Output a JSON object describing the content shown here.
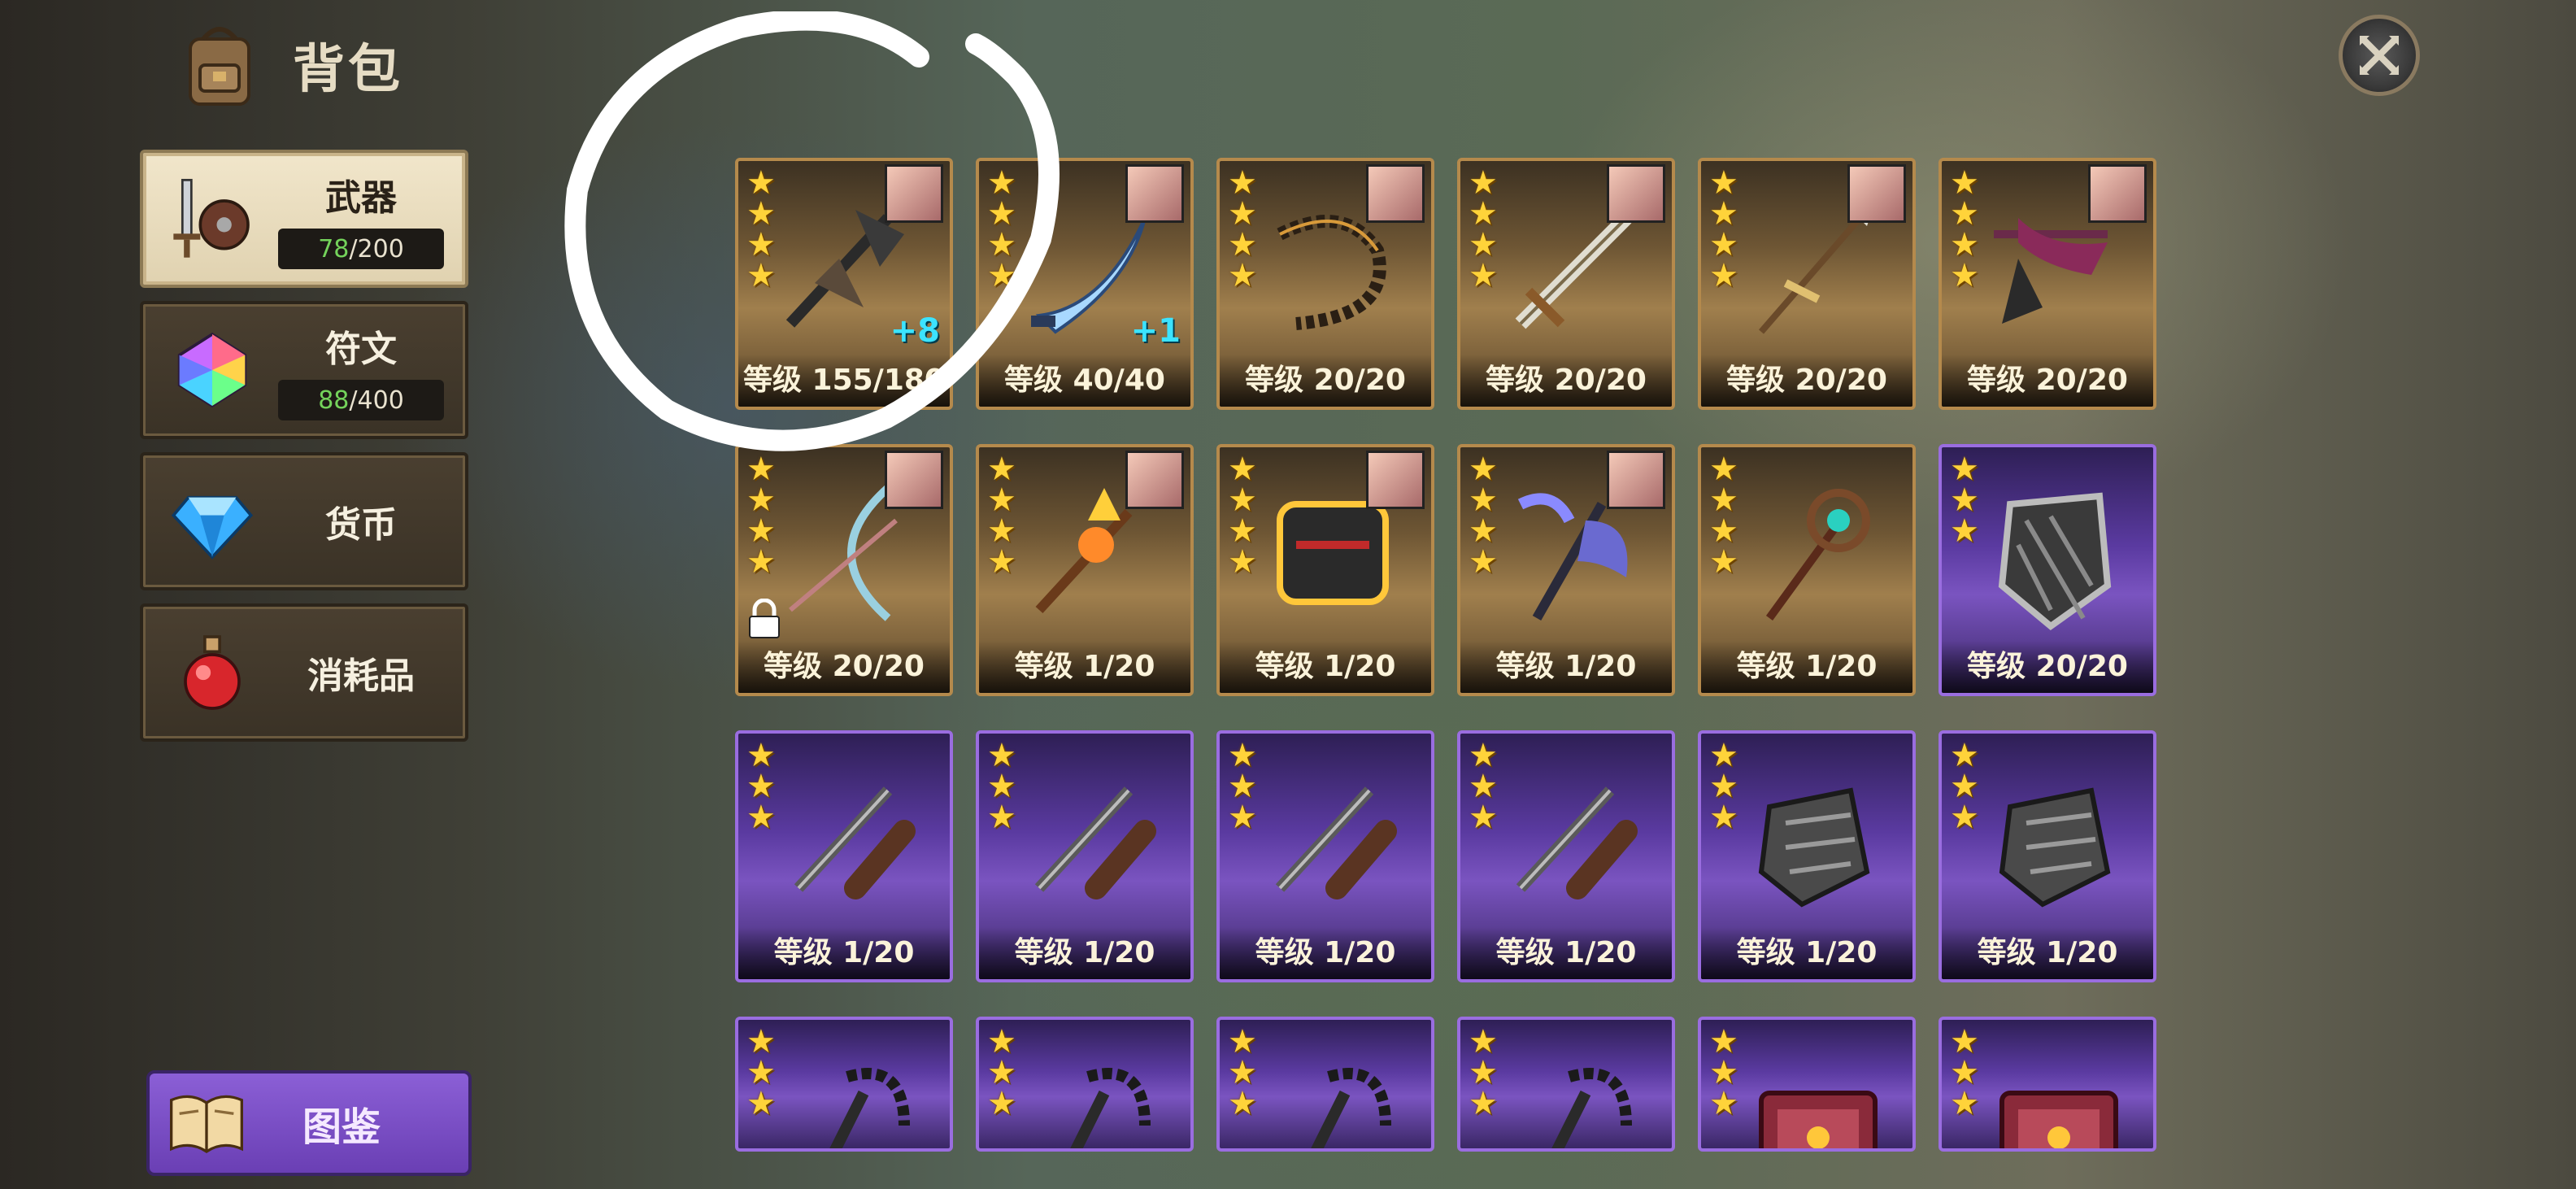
{
  "header": {
    "title": "背包",
    "icon": "backpack-icon"
  },
  "close_button": {
    "icon": "close-icon"
  },
  "categories": [
    {
      "label": "武器",
      "icon": "sword-shield-icon",
      "current": "78",
      "total": "/200",
      "active": true
    },
    {
      "label": "符文",
      "icon": "rainbow-gem-icon",
      "current": "88",
      "total": "/400",
      "active": false
    },
    {
      "label": "货币",
      "icon": "blue-diamond-icon",
      "active": false
    },
    {
      "label": "消耗品",
      "icon": "potion-icon",
      "active": false
    }
  ],
  "atlas_button": {
    "label": "图鉴",
    "icon": "book-icon"
  },
  "items": [
    {
      "rarity": "gold",
      "stars": 4,
      "level": "等级 155/180",
      "plus": "+8",
      "portrait": true,
      "art": "dark-halberd",
      "locked": false
    },
    {
      "rarity": "gold",
      "stars": 4,
      "level": "等级 40/40",
      "plus": "+1",
      "portrait": true,
      "art": "ice-scimitar",
      "locked": false
    },
    {
      "rarity": "gold",
      "stars": 4,
      "level": "等级 20/20",
      "plus": "",
      "portrait": true,
      "art": "chain-whip",
      "locked": false
    },
    {
      "rarity": "gold",
      "stars": 4,
      "level": "等级 20/20",
      "plus": "",
      "portrait": true,
      "art": "greatsword",
      "locked": false
    },
    {
      "rarity": "gold",
      "stars": 4,
      "level": "等级 20/20",
      "plus": "",
      "portrait": true,
      "art": "spear",
      "locked": false
    },
    {
      "rarity": "gold",
      "stars": 4,
      "level": "等级 20/20",
      "plus": "",
      "portrait": true,
      "art": "dragon-crossbow",
      "locked": false
    },
    {
      "rarity": "gold",
      "stars": 4,
      "level": "等级 20/20",
      "plus": "",
      "portrait": true,
      "art": "bow",
      "locked": true
    },
    {
      "rarity": "gold",
      "stars": 4,
      "level": "等级 1/20",
      "plus": "",
      "portrait": true,
      "art": "fire-staff",
      "locked": false
    },
    {
      "rarity": "gold",
      "stars": 4,
      "level": "等级 1/20",
      "plus": "",
      "portrait": true,
      "art": "gauntlet",
      "locked": false
    },
    {
      "rarity": "gold",
      "stars": 4,
      "level": "等级 1/20",
      "plus": "",
      "portrait": true,
      "art": "shadow-axe",
      "locked": false
    },
    {
      "rarity": "gold",
      "stars": 4,
      "level": "等级 1/20",
      "plus": "",
      "portrait": false,
      "art": "orb-staff",
      "locked": false
    },
    {
      "rarity": "purple",
      "stars": 3,
      "level": "等级 20/20",
      "plus": "",
      "portrait": false,
      "art": "iron-shield",
      "locked": false
    },
    {
      "rarity": "purple",
      "stars": 3,
      "level": "等级 1/20",
      "plus": "",
      "portrait": false,
      "art": "sword-sheath",
      "locked": false
    },
    {
      "rarity": "purple",
      "stars": 3,
      "level": "等级 1/20",
      "plus": "",
      "portrait": false,
      "art": "sword-sheath",
      "locked": false
    },
    {
      "rarity": "purple",
      "stars": 3,
      "level": "等级 1/20",
      "plus": "",
      "portrait": false,
      "art": "sword-sheath",
      "locked": false
    },
    {
      "rarity": "purple",
      "stars": 3,
      "level": "等级 1/20",
      "plus": "",
      "portrait": false,
      "art": "sword-sheath",
      "locked": false
    },
    {
      "rarity": "purple",
      "stars": 3,
      "level": "等级 1/20",
      "plus": "",
      "portrait": false,
      "art": "iron-gauntlet",
      "locked": false
    },
    {
      "rarity": "purple",
      "stars": 3,
      "level": "等级 1/20",
      "plus": "",
      "portrait": false,
      "art": "iron-gauntlet",
      "locked": false
    },
    {
      "rarity": "purple",
      "stars": 3,
      "level": "",
      "plus": "",
      "portrait": false,
      "art": "flail",
      "locked": false
    },
    {
      "rarity": "purple",
      "stars": 3,
      "level": "",
      "plus": "",
      "portrait": false,
      "art": "flail",
      "locked": false
    },
    {
      "rarity": "purple",
      "stars": 3,
      "level": "",
      "plus": "",
      "portrait": false,
      "art": "flail",
      "locked": false
    },
    {
      "rarity": "purple",
      "stars": 3,
      "level": "",
      "plus": "",
      "portrait": false,
      "art": "flail",
      "locked": false
    },
    {
      "rarity": "purple",
      "stars": 3,
      "level": "",
      "plus": "",
      "portrait": false,
      "art": "spellbook",
      "locked": false
    },
    {
      "rarity": "purple",
      "stars": 3,
      "level": "",
      "plus": "",
      "portrait": false,
      "art": "spellbook",
      "locked": false
    }
  ],
  "colors": {
    "gold_border": "#b58a4c",
    "purple_border": "#9a6de0",
    "star": "#ffd33a",
    "plus": "#3ce3ff",
    "count_current": "#74d35b"
  }
}
